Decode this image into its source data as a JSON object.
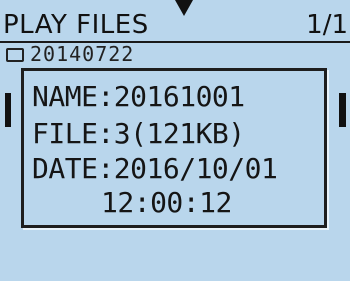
{
  "header": {
    "title": "PLAY FILES",
    "page_indicator": "1/1"
  },
  "list": {
    "first_item_name": "20140722"
  },
  "info_popup": {
    "name_line": "NAME:20161001",
    "file_line": "FILE:3(121KB)",
    "date_line": "DATE:2016/10/01",
    "time_line": "12:00:12"
  }
}
